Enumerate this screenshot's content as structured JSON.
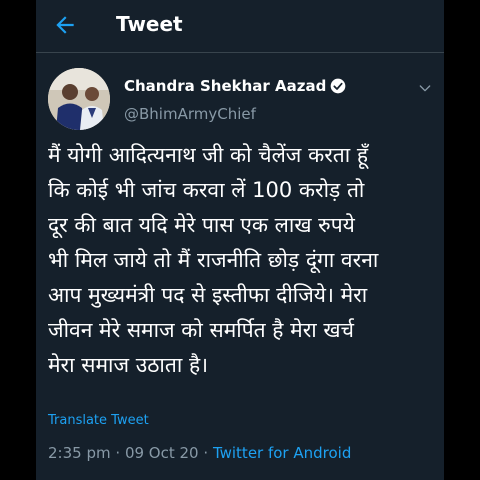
{
  "header": {
    "title": "Tweet"
  },
  "author": {
    "name": "Chandra Shekhar Aazad",
    "handle": "@BhimArmyChief",
    "verified": true
  },
  "tweet": {
    "text": "मैं योगी आदित्यनाथ जी को चैलेंज करता हूँ\nकि कोई भी जांच करवा लें 100 करोड़ तो\nदूर की बात यदि मेरे पास एक लाख रुपये\nभी मिल जाये तो मैं राजनीति छोड़ दूंगा वरना\nआप मुख्यमंत्री पद से इस्तीफा दीजिये। मेरा\nजीवन मेरे समाज को समर्पित है मेरा खर्च\nमेरा समाज उठाता है।",
    "translate_label": "Translate Tweet",
    "time": "2:35 pm",
    "separator1": "·",
    "date": "09 Oct 20",
    "separator2": "·",
    "source": "Twitter for Android"
  },
  "icons": {
    "back": "back-arrow-icon",
    "verified": "verified-badge-icon",
    "caret": "chevron-down-icon"
  },
  "colors": {
    "background": "#15202b",
    "accent": "#1da1f2",
    "secondary_text": "#8899a6",
    "primary_text": "#ffffff"
  }
}
